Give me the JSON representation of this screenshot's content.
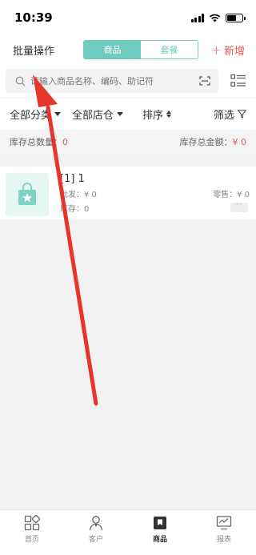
{
  "status_bar": {
    "time": "10:39"
  },
  "header": {
    "batch_label": "批量操作",
    "tabs": [
      {
        "label": "商品",
        "active": true
      },
      {
        "label": "套餐",
        "active": false
      }
    ],
    "add_label": "新增"
  },
  "search": {
    "placeholder": "请输入商品名称、编码、助记符"
  },
  "filters": {
    "category": "全部分类",
    "store": "全部店仓",
    "sort": "排序",
    "filter": "筛选"
  },
  "summary": {
    "qty_label": "库存总数量：",
    "qty_value": "0",
    "amount_label": "库存总金额：",
    "amount_value": "¥ 0"
  },
  "products": [
    {
      "name": "[1] 1",
      "wholesale_label": "批发：",
      "wholesale_value": "¥ 0",
      "retail_label": "零售：",
      "retail_value": "¥ 0",
      "stock_label": "库存：",
      "stock_value": "0"
    }
  ],
  "tabbar": [
    {
      "label": "首页",
      "icon": "home-grid-icon",
      "active": false
    },
    {
      "label": "客户",
      "icon": "customer-icon",
      "active": false
    },
    {
      "label": "商品",
      "icon": "product-icon",
      "active": true
    },
    {
      "label": "报表",
      "icon": "report-icon",
      "active": false
    }
  ],
  "colors": {
    "accent": "#6fcbbd",
    "red": "#e9584f",
    "annotation_arrow": "#e8352b"
  }
}
